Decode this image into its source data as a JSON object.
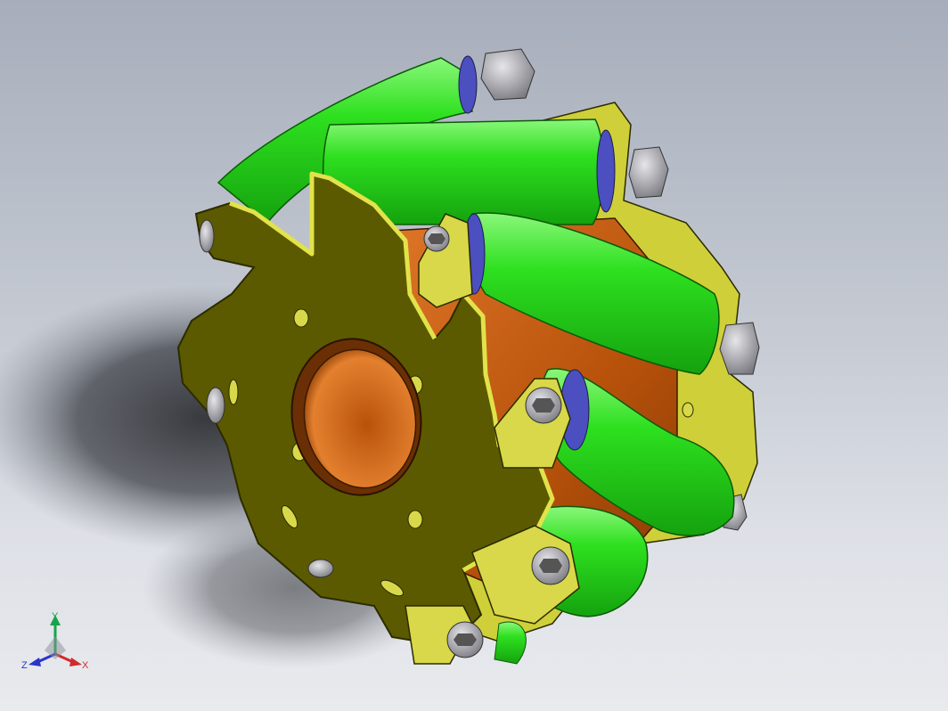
{
  "viewport": {
    "background_top": "#a7aebb",
    "background_bottom": "#e8eaee"
  },
  "model": {
    "part_colors": {
      "side_plate": "#5b5a00",
      "side_plate_edge": "#d8d84a",
      "roller": "#27d31b",
      "roller_highlight": "#7cf06b",
      "hub": "#c05a10",
      "hub_highlight": "#e88a3a",
      "bearing_ring": "#4b4fbf",
      "bolt": "#b5b5b9"
    }
  },
  "triad": {
    "y_label": "Y",
    "z_label": "Z",
    "x_label": "X",
    "y_color": "#1aa34a",
    "z_color": "#2a36c8",
    "x_color": "#d22a2a",
    "y_icon": "y-axis-arrow-icon",
    "z_icon": "z-axis-arrow-icon",
    "x_icon": "x-axis-arrow-icon"
  }
}
